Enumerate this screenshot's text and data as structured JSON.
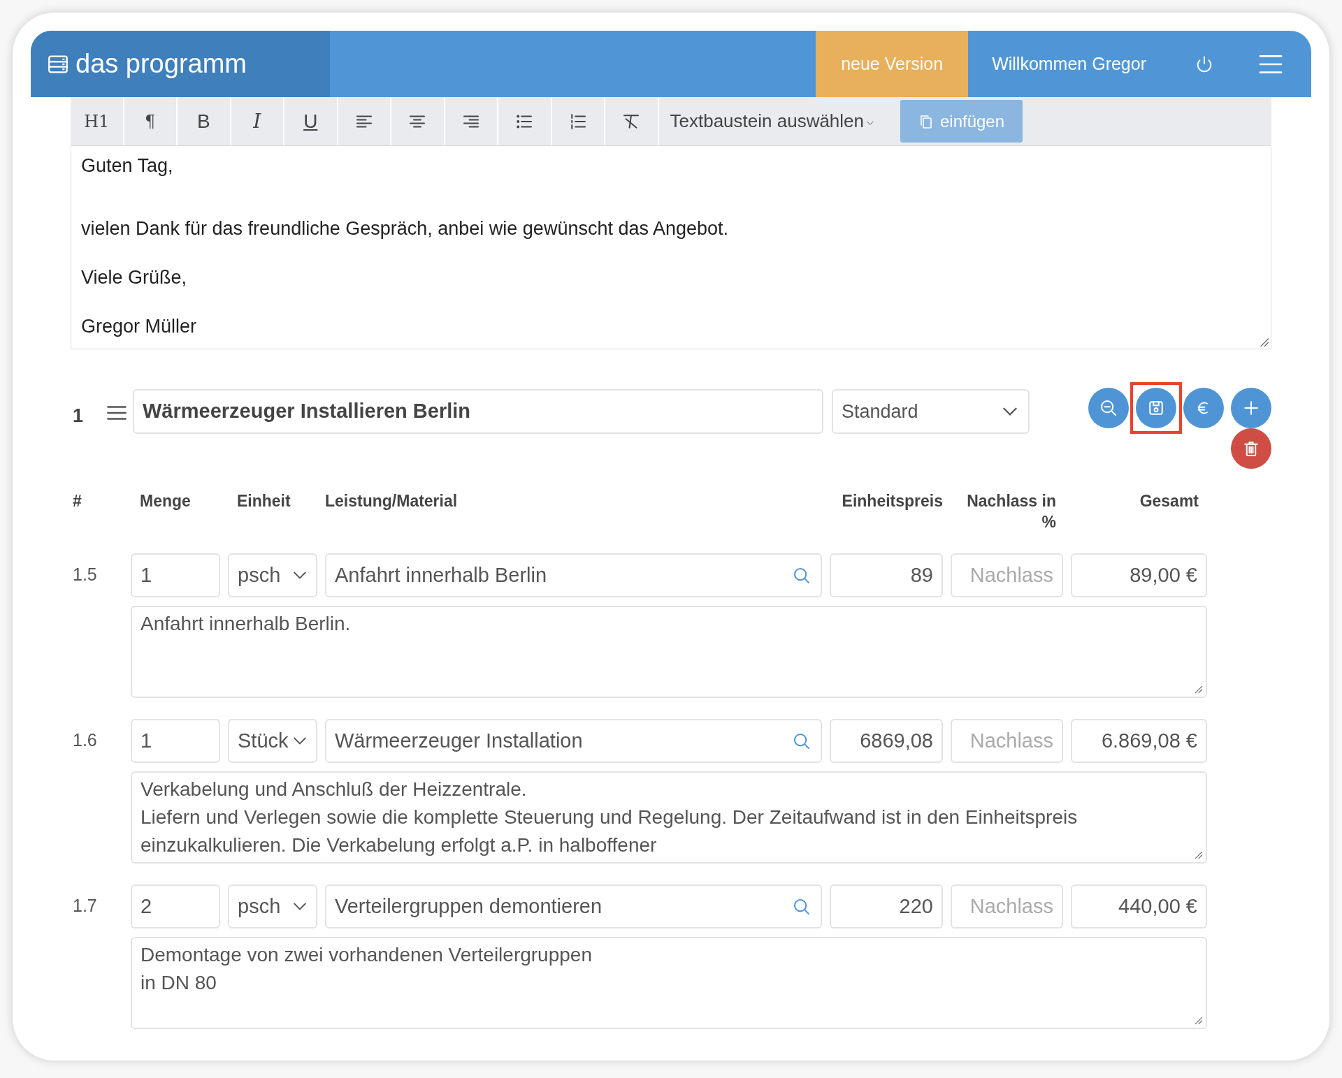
{
  "app": {
    "title": "das programm",
    "new_version": "neue Version",
    "welcome": "Willkommen Gregor"
  },
  "toolbar": [
    {
      "kind": "text",
      "label": "H1"
    },
    {
      "kind": "text",
      "label": "¶"
    },
    {
      "kind": "bold",
      "label": "B"
    },
    {
      "kind": "italic",
      "label": "I"
    },
    {
      "kind": "underline",
      "label": "U"
    },
    {
      "kind": "align-left"
    },
    {
      "kind": "align-center"
    },
    {
      "kind": "align-right"
    },
    {
      "kind": "bullet-list"
    },
    {
      "kind": "numbered-list"
    },
    {
      "kind": "clear-format"
    }
  ],
  "snippet": {
    "value": "Textbaustein auswählen",
    "button": "einfügen",
    "disabled": true
  },
  "editor": {
    "paragraphs": [
      "Guten Tag,",
      "vielen Dank für das freundliche Gespräch, anbei wie gewünscht das Angebot.",
      "Viele Grüße,",
      "Gregor Müller"
    ]
  },
  "position": {
    "number": "1",
    "title": "Wärmeerzeuger Installieren Berlin",
    "type": "Standard",
    "actions": [
      {
        "kind": "zoom-out",
        "highlighted": false
      },
      {
        "kind": "save",
        "highlighted": true
      },
      {
        "kind": "euro",
        "highlighted": false
      },
      {
        "kind": "add",
        "highlighted": false
      },
      {
        "kind": "delete",
        "highlighted": false
      }
    ]
  },
  "table": {
    "columns": [
      "#",
      "Menge",
      "Einheit",
      "Leistung/Material",
      "Einheitspreis",
      "Nachlass in %",
      "Gesamt"
    ],
    "rows": [
      {
        "number": "1.5",
        "quantity": "1",
        "unit": "psch",
        "item": "Anfahrt innerhalb Berlin",
        "unit_price": "89",
        "discount": {
          "placeholder": "Nachlass"
        },
        "total": "89,00 €",
        "description": [
          "Anfahrt innerhalb Berlin."
        ]
      },
      {
        "number": "1.6",
        "quantity": "1",
        "unit": "Stück",
        "item": "Wärmeerzeuger Installation",
        "unit_price": "6869,08",
        "discount": {
          "placeholder": "Nachlass"
        },
        "total": "6.869,08 €",
        "description": [
          "Verkabelung und Anschluß der Heizzentrale.",
          "Liefern und Verlegen sowie die komplette Steuerung und Regelung. Der Zeitaufwand ist in den Einheitspreis",
          "einzukalkulieren. Die Verkabelung erfolgt a.P. in halboffener"
        ]
      },
      {
        "number": "1.7",
        "quantity": "2",
        "unit": "psch",
        "item": "Verteilergruppen demontieren",
        "unit_price": "220",
        "discount": {
          "placeholder": "Nachlass"
        },
        "total": "440,00 €",
        "description": [
          "Demontage von zwei vorhandenen Verteilergruppen",
          "in DN 80"
        ]
      }
    ]
  }
}
